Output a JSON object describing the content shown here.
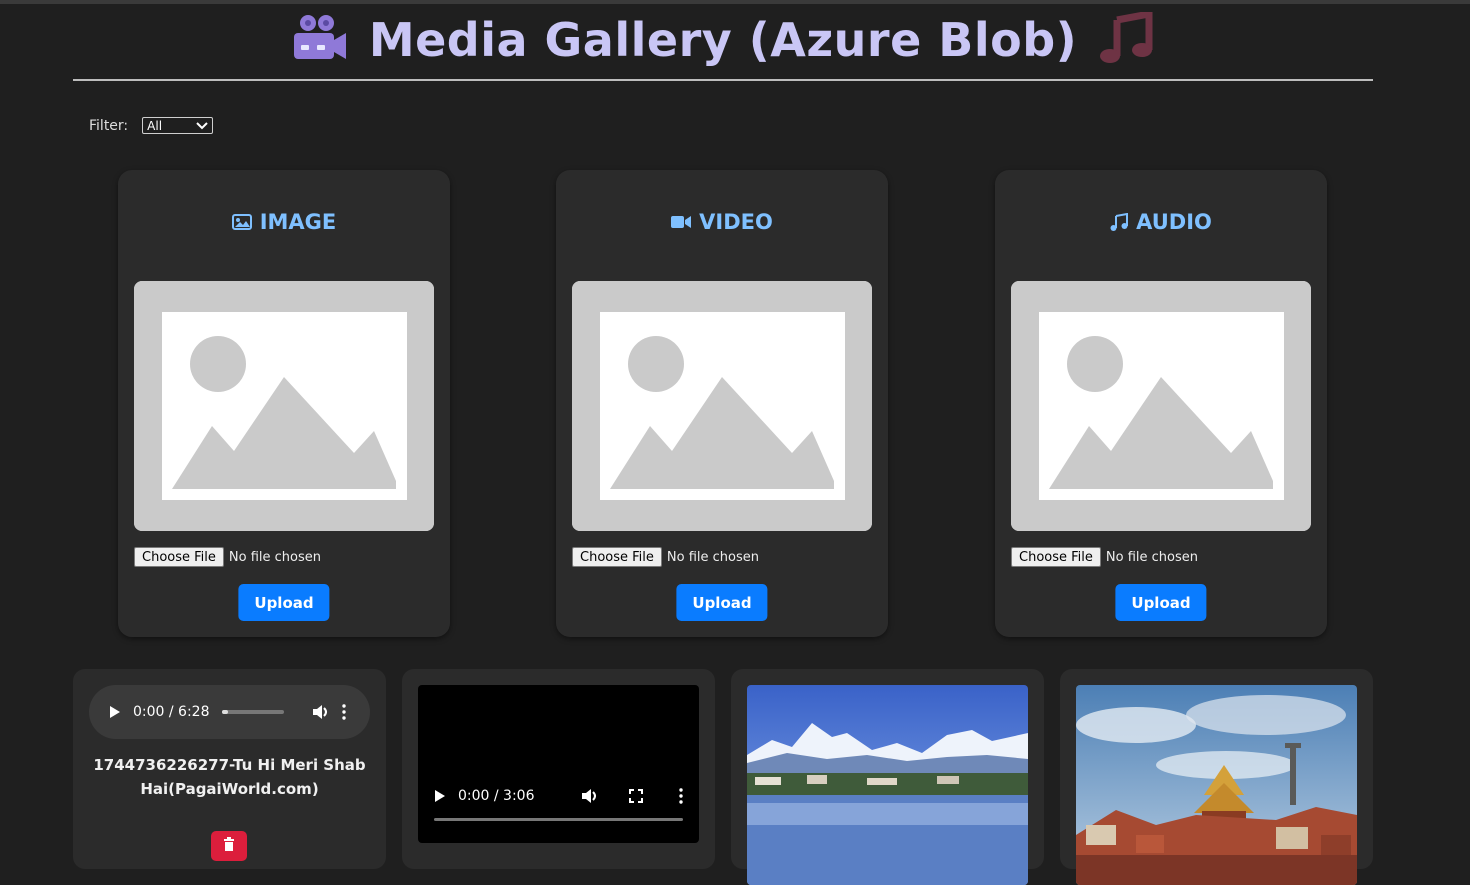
{
  "header": {
    "icon_left": "movie-camera-icon",
    "title": "Media Gallery (Azure Blob)",
    "icon_right": "music-note-icon"
  },
  "filter": {
    "label": "Filter:",
    "selected": "All"
  },
  "upload_cards": [
    {
      "title": "IMAGE",
      "icon": "image-icon",
      "choose_label": "Choose File",
      "file_status": "No file chosen",
      "upload_label": "Upload"
    },
    {
      "title": "VIDEO",
      "icon": "video-camera-icon",
      "choose_label": "Choose File",
      "file_status": "No file chosen",
      "upload_label": "Upload"
    },
    {
      "title": "AUDIO",
      "icon": "music-note-icon",
      "choose_label": "Choose File",
      "file_status": "No file chosen",
      "upload_label": "Upload"
    }
  ],
  "gallery": {
    "audio_item": {
      "time": "0:00 / 6:28",
      "progress": 0.1,
      "name": "1744736226277-Tu Hi Meri Shab Hai(PagaiWorld.com)"
    },
    "video_item": {
      "time": "0:00 / 3:06"
    }
  },
  "colors": {
    "background": "#1f1f1f",
    "card": "#2b2b2b",
    "accent": "#0a7cff",
    "title": "#c9c6f5",
    "card_title": "#7fc0ff",
    "delete": "#dc1e3c"
  }
}
